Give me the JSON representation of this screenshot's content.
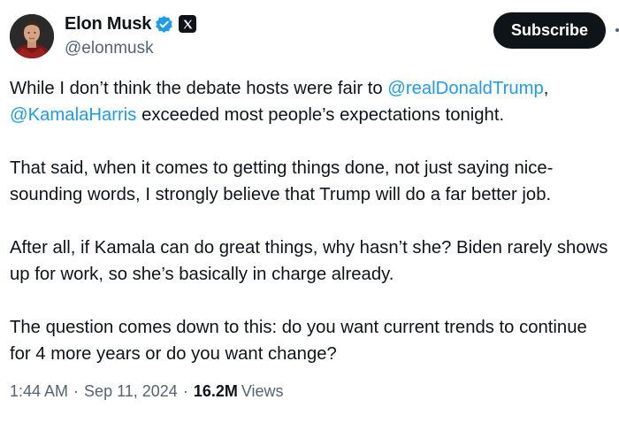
{
  "author": {
    "display_name": "Elon Musk",
    "handle": "@elonmusk",
    "avatar_icon": "profile-photo",
    "verified_icon": "verified-badge-icon",
    "affiliation_icon": "x-logo-icon",
    "verified_color": "#1d9bf0"
  },
  "actions": {
    "subscribe_label": "Subscribe"
  },
  "tweet": {
    "p1_a": "While I don’t think the debate hosts were fair to ",
    "mention_1": "@realDonaldTrump",
    "p1_b": ",",
    "mention_2": "@KamalaHarris",
    "p1_c": " exceeded most people’s expectations tonight.",
    "p2": "That said, when it comes to getting things done, not just saying nice-sounding words, I strongly believe that Trump will do a far better job.",
    "p3": "After all, if Kamala can do great things, why hasn’t she? Biden rarely shows up for work, so she’s basically in charge already.",
    "p4": "The question comes down to this: do you want current trends to continue for 4 more years or do you want change?"
  },
  "meta": {
    "time": "1:44 AM",
    "separator": "·",
    "date": "Sep 11, 2024",
    "views_count": "16.2M",
    "views_label": "Views"
  },
  "colors": {
    "link": "#1d9bf0",
    "text": "#0f1419",
    "secondary": "#536471",
    "button_bg": "#0f1419"
  }
}
